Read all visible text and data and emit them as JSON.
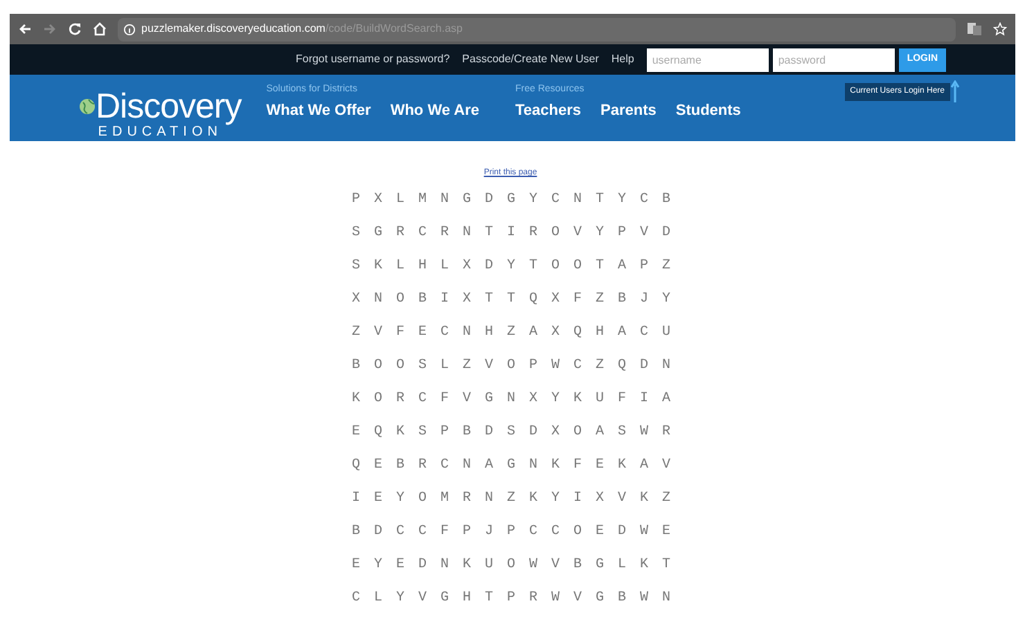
{
  "browser": {
    "url_host": "puzzlemaker.discoveryeducation.com",
    "url_path": "/code/BuildWordSearch.asp"
  },
  "top_bar": {
    "links": [
      "Forgot username or password?",
      "Passcode/Create New User",
      "Help"
    ],
    "username": {
      "placeholder": "username"
    },
    "password": {
      "placeholder": "password"
    },
    "login": "LOGIN"
  },
  "header": {
    "logo": {
      "word": "Discovery",
      "sub": "EDUCATION"
    },
    "groups": [
      {
        "caption": "Solutions for Districts",
        "items": [
          "What We Offer",
          "Who We Are"
        ]
      },
      {
        "caption": "Free Resources",
        "items": [
          "Teachers",
          "Parents",
          "Students"
        ]
      }
    ],
    "login_hint": "Current Users Login Here"
  },
  "print_link": "Print this page",
  "grid": [
    [
      "P",
      "X",
      "L",
      "M",
      "N",
      "G",
      "D",
      "G",
      "Y",
      "C",
      "N",
      "T",
      "Y",
      "C",
      "B"
    ],
    [
      "S",
      "G",
      "R",
      "C",
      "R",
      "N",
      "T",
      "I",
      "R",
      "O",
      "V",
      "Y",
      "P",
      "V",
      "D"
    ],
    [
      "S",
      "K",
      "L",
      "H",
      "L",
      "X",
      "D",
      "Y",
      "T",
      "O",
      "O",
      "T",
      "A",
      "P",
      "Z"
    ],
    [
      "X",
      "N",
      "O",
      "B",
      "I",
      "X",
      "T",
      "T",
      "Q",
      "X",
      "F",
      "Z",
      "B",
      "J",
      "Y"
    ],
    [
      "Z",
      "V",
      "F",
      "E",
      "C",
      "N",
      "H",
      "Z",
      "A",
      "X",
      "Q",
      "H",
      "A",
      "C",
      "U"
    ],
    [
      "B",
      "O",
      "O",
      "S",
      "L",
      "Z",
      "V",
      "O",
      "P",
      "W",
      "C",
      "Z",
      "Q",
      "D",
      "N"
    ],
    [
      "K",
      "O",
      "R",
      "C",
      "F",
      "V",
      "G",
      "N",
      "X",
      "Y",
      "K",
      "U",
      "F",
      "I",
      "A"
    ],
    [
      "E",
      "Q",
      "K",
      "S",
      "P",
      "B",
      "D",
      "S",
      "D",
      "X",
      "O",
      "A",
      "S",
      "W",
      "R"
    ],
    [
      "Q",
      "E",
      "B",
      "R",
      "C",
      "N",
      "A",
      "G",
      "N",
      "K",
      "F",
      "E",
      "K",
      "A",
      "V"
    ],
    [
      "I",
      "E",
      "Y",
      "O",
      "M",
      "R",
      "N",
      "Z",
      "K",
      "Y",
      "I",
      "X",
      "V",
      "K",
      "Z"
    ],
    [
      "B",
      "D",
      "C",
      "C",
      "F",
      "P",
      "J",
      "P",
      "C",
      "C",
      "O",
      "E",
      "D",
      "W",
      "E"
    ],
    [
      "E",
      "Y",
      "E",
      "D",
      "N",
      "K",
      "U",
      "O",
      "W",
      "V",
      "B",
      "G",
      "L",
      "K",
      "T"
    ],
    [
      "C",
      "L",
      "Y",
      "V",
      "G",
      "H",
      "T",
      "P",
      "R",
      "W",
      "V",
      "G",
      "B",
      "W",
      "N"
    ]
  ]
}
